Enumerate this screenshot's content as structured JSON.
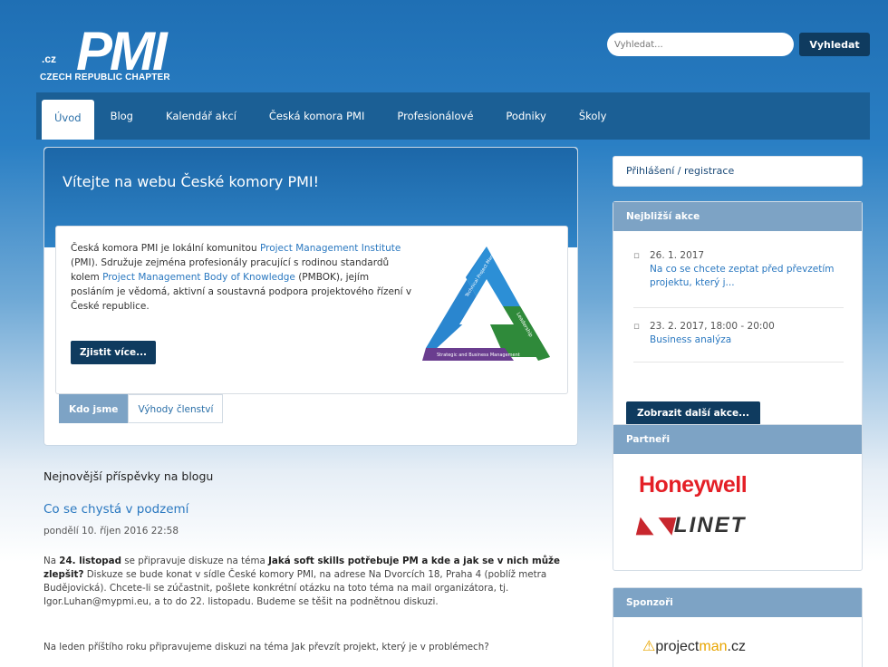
{
  "logo": {
    "mark": "PMI",
    "country": ".cz",
    "chapter": "CZECH REPUBLIC CHAPTER"
  },
  "search": {
    "placeholder": "Vyhledat...",
    "button": "Vyhledat"
  },
  "nav": {
    "items": [
      "Úvod",
      "Blog",
      "Kalendář akcí",
      "Česká komora PMI",
      "Profesionálové",
      "Podniky",
      "Školy"
    ],
    "active_index": 0
  },
  "hero": {
    "title": "Vítejte na webu České komory PMI!",
    "text_1": "Česká komora PMI je lokální komunitou ",
    "link_1": "Project Management Institute",
    "text_2": " (PMI). Sdružuje zejména profesionály pracující s rodinou standardů kolem ",
    "link_2": "Project Management Body of Knowledge",
    "text_3": " (PMBOK), jejím posláním je vědomá, aktivní a soustavná podpora projektového řízení v České republice.",
    "button": "Zjistit více...",
    "triangle": {
      "left": "Technical Project Management",
      "right": "Leadership",
      "bottom": "Strategic and Business Management"
    },
    "tabs": [
      "Kdo jsme",
      "Výhody členství"
    ]
  },
  "blog": {
    "heading": "Nejnovější příspěvky na blogu",
    "post_title": "Co se chystá v podzemí",
    "post_date": "pondělí 10. říjen 2016 22:58",
    "p1_a": "Na ",
    "p1_b": "24. listopad",
    "p1_c": " se připravuje diskuze na téma ",
    "p1_d": "Jaká soft skills potřebuje PM a kde a jak se v nich může zlepšit?",
    "p1_e": " Diskuze se bude konat v sídle České komory PMI, na adrese Na Dvorcích 18, Praha 4 (poblíž metra Budějovická). Chcete-li se zúčastnit, pošlete konkrétní otázku na toto téma na mail organizátora, tj. Igor.Luhan@mypmi.eu, a to do 22. listopadu. Budeme se těšit na podnětnou diskuzi.",
    "p2": "Na leden příštího roku připravujeme diskuzi na téma Jak převzít projekt, který je v problémech?"
  },
  "sidebar": {
    "login": "Přihlášení / registrace",
    "events_title": "Nejbližší akce",
    "events": [
      {
        "date": "26. 1. 2017",
        "title": "Na co se chcete zeptat před převzetím projektu, který j..."
      },
      {
        "date": "23. 2. 2017, 18:00 - 20:00",
        "title": "Business analýza"
      }
    ],
    "more_button": "Zobrazit další akce...",
    "partners_title": "Partneři",
    "partners": [
      "Honeywell",
      "LINET"
    ],
    "sponsors_title": "Sponzoři",
    "sponsor_a": "project",
    "sponsor_b": "man",
    "sponsor_c": ".cz"
  },
  "colors": {
    "nav": "#1b5f95",
    "button": "#0f3b5f",
    "link": "#2a78c0",
    "box_head": "#7da3c5",
    "honeywell": "#e41f26"
  }
}
